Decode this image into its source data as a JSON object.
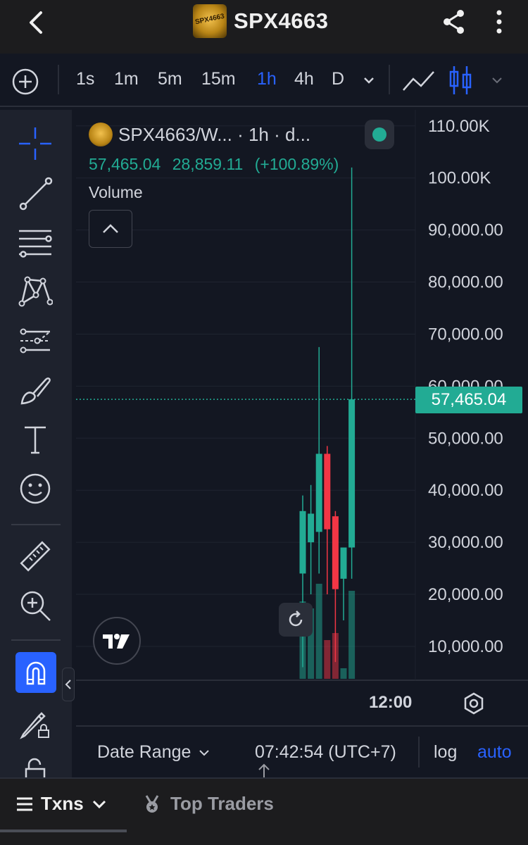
{
  "appbar": {
    "title": "SPX4663",
    "logo_text": "SPX4663",
    "icons": [
      "back-arrow-icon",
      "share-icon",
      "more-vertical-icon"
    ]
  },
  "toolbar": {
    "intervals": [
      "1s",
      "1m",
      "5m",
      "15m",
      "1h",
      "4h",
      "D"
    ],
    "active_interval": "1h",
    "chart_type_icons": [
      "line-chart-icon",
      "candlestick-icon"
    ]
  },
  "sidebar": {
    "tools": [
      "crosshair-icon",
      "trend-line-icon",
      "fib-levels-icon",
      "pattern-icon",
      "forecast-icon",
      "brush-icon",
      "text-icon",
      "emoji-icon",
      "ruler-icon",
      "zoom-in-icon",
      "magnet-icon",
      "lock-drawing-icon",
      "unlock-icon"
    ]
  },
  "legend": {
    "title": "SPX4663/W... · 1h · d...",
    "last_price": "57,465.04",
    "change": "28,859.11",
    "change_pct": "(+100.89%)",
    "volume_label": "Volume"
  },
  "colors": {
    "up": "#22ab94",
    "down": "#f23645",
    "accent": "#2962ff",
    "background": "#131722"
  },
  "chart_data": {
    "type": "candlestick",
    "price_label": "57,465.04",
    "y_tick_labels": [
      "110.00K",
      "100.00K",
      "90,000.00",
      "80,000.00",
      "70,000.00",
      "60,000.00",
      "50,000.00",
      "40,000.00",
      "30,000.00",
      "20,000.00",
      "10,000.00"
    ],
    "y_tick_values": [
      110000,
      100000,
      90000,
      80000,
      70000,
      60000,
      50000,
      40000,
      30000,
      20000,
      10000
    ],
    "x_tick_label": "12:00",
    "ylim": [
      3500,
      112000
    ],
    "candles": [
      {
        "open": 24000,
        "high": 39000,
        "low": 6000,
        "close": 36000
      },
      {
        "open": 30000,
        "high": 41000,
        "low": 20000,
        "close": 35500
      },
      {
        "open": 32000,
        "high": 67500,
        "low": 24000,
        "close": 47000
      },
      {
        "open": 47000,
        "high": 48500,
        "low": 20000,
        "close": 32500
      },
      {
        "open": 35000,
        "high": 36000,
        "low": 7000,
        "close": 21000
      },
      {
        "open": 23000,
        "high": 29000,
        "low": 15000,
        "close": 29000
      },
      {
        "open": 29000,
        "high": 102000,
        "low": 23000,
        "close": 57465.04
      }
    ],
    "volumes": [
      22,
      20,
      27,
      11,
      13,
      3,
      25
    ],
    "grid": true
  },
  "chart_ui": {
    "reset_icon": "reset-view-icon",
    "settings_icon": "settings-hexagon-icon"
  },
  "chartbar": {
    "date_range": "Date Range",
    "clock": "07:42:54 (UTC+7)",
    "log": "log",
    "auto": "auto"
  },
  "bottom_tabs": {
    "txns": "Txns",
    "top_traders": "Top Traders"
  }
}
